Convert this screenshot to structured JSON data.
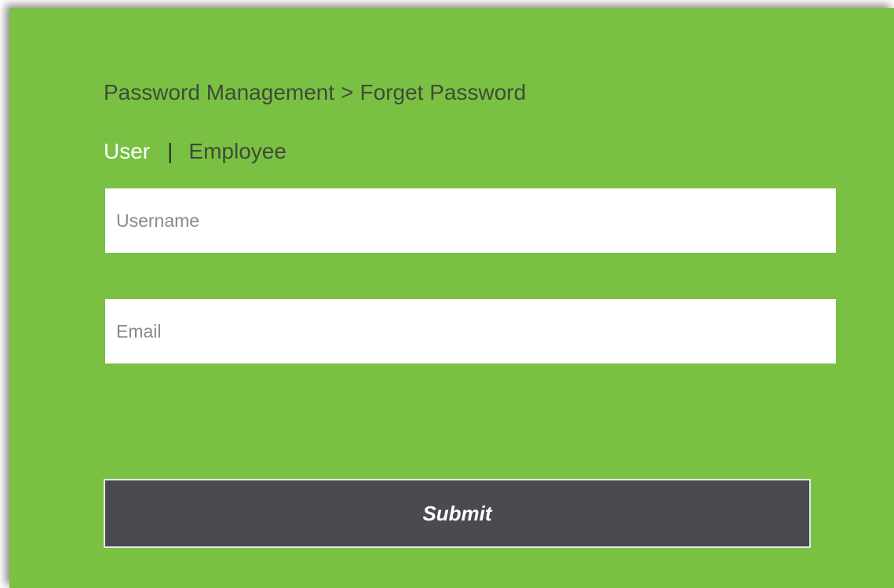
{
  "breadcrumb": {
    "parent": "Password Management",
    "separator": ">",
    "current": "Forget Password"
  },
  "tabs": {
    "user": "User",
    "divider": "|",
    "employee": "Employee",
    "active": "User"
  },
  "form": {
    "username_placeholder": "Username",
    "username_value": "",
    "email_placeholder": "Email",
    "email_value": "",
    "submit_label": "Submit"
  },
  "colors": {
    "panel_background": "#7ac143",
    "submit_background": "#4a4b50",
    "active_tab": "#ffffff"
  }
}
